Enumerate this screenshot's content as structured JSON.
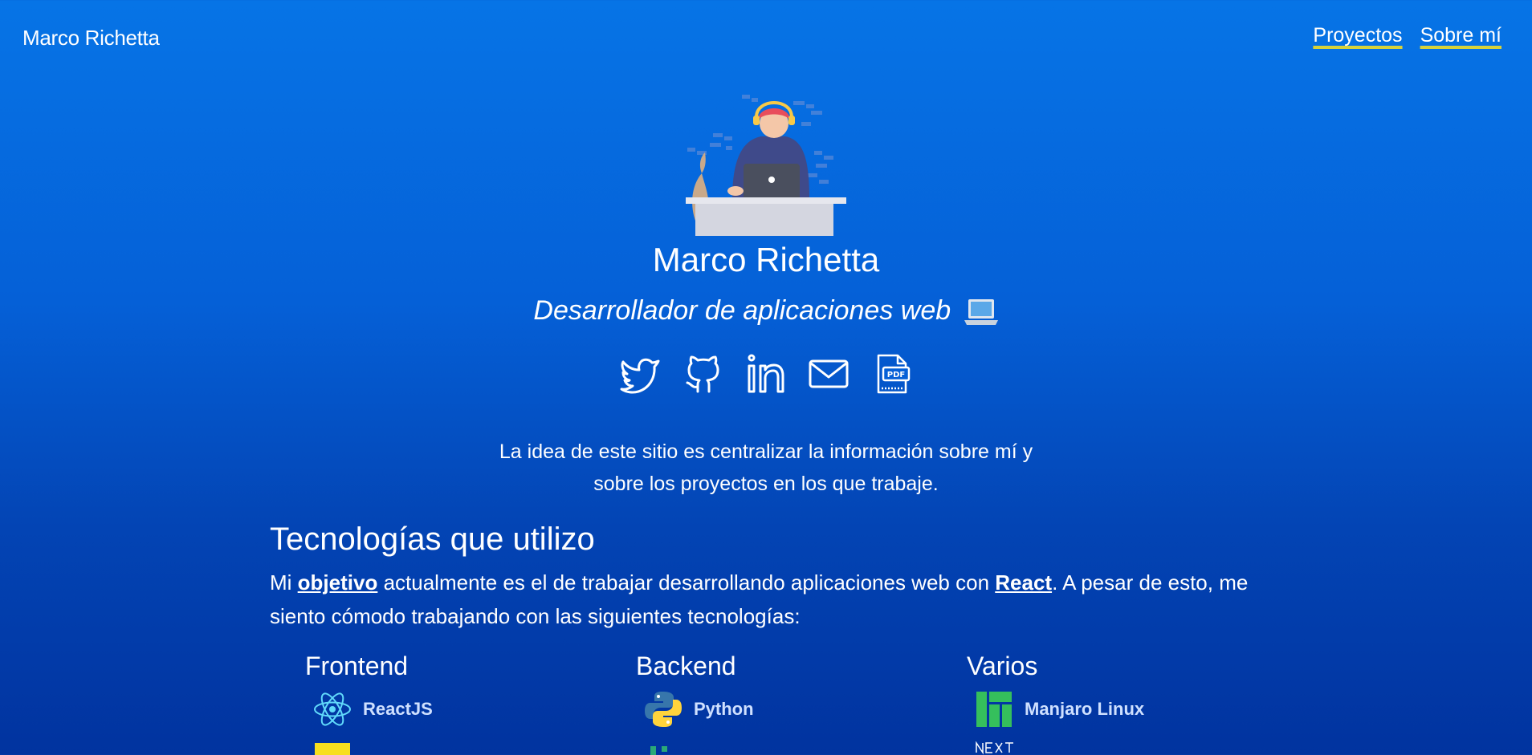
{
  "nav": {
    "brand": "Marco Richetta",
    "links": [
      {
        "label": "Proyectos"
      },
      {
        "label": "Sobre mí"
      }
    ]
  },
  "hero": {
    "name": "Marco Richetta",
    "subtitle": "Desarrollador de aplicaciones web",
    "emoji_icon": "laptop-icon",
    "social_icons": [
      "twitter-icon",
      "github-icon",
      "linkedin-icon",
      "mail-icon",
      "pdf-icon"
    ],
    "intro_line1": "La idea de este sitio es centralizar la información sobre mí y",
    "intro_line2": "sobre los proyectos en los que trabaje."
  },
  "tech": {
    "title": "Tecnologías que utilizo",
    "text_part1": "Mi ",
    "link_objetivo": "objetivo",
    "text_part2": " actualmente es el de trabajar desarrollando aplicaciones web con ",
    "link_react": "React",
    "text_part3": ". A pesar de esto, me siento cómodo trabajando con las siguientes tecnologías:",
    "columns": [
      {
        "title": "Frontend",
        "items": [
          {
            "label": "ReactJS",
            "icon": "react-icon"
          },
          {
            "label": "",
            "icon": "javascript-icon"
          }
        ]
      },
      {
        "title": "Backend",
        "items": [
          {
            "label": "Python",
            "icon": "python-icon"
          },
          {
            "label": "",
            "icon": "django-icon"
          }
        ]
      },
      {
        "title": "Varios",
        "items": [
          {
            "label": "Manjaro Linux",
            "icon": "manjaro-icon"
          },
          {
            "label": "",
            "icon": "nextjs-icon"
          }
        ]
      }
    ]
  },
  "colors": {
    "accent_underline": "#d7d23a",
    "background_top": "#0674e6",
    "background_bottom": "#01339f"
  }
}
